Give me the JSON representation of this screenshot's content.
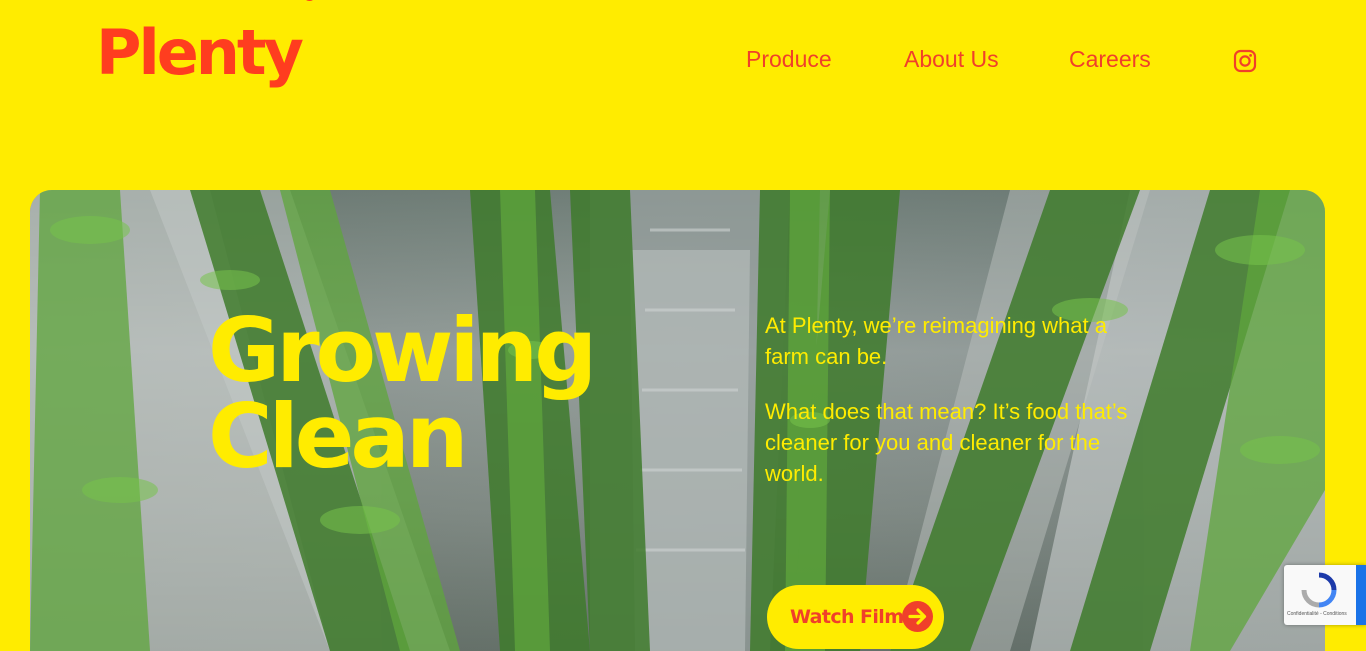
{
  "brand": {
    "name": "Plenty",
    "registered": "®"
  },
  "nav": {
    "items": [
      {
        "label": "Produce"
      },
      {
        "label": "About Us"
      },
      {
        "label": "Careers"
      }
    ],
    "social_icon": "instagram-icon"
  },
  "hero": {
    "headline_line1": "Growing",
    "headline_line2": "Clean",
    "paragraph1": "At Plenty, we’re reimagining what a farm can be.",
    "paragraph2": "What does that mean? It’s food that’s cleaner for you and cleaner for the world.",
    "cta_label": "Watch Film",
    "cta_icon": "arrow-right-icon"
  },
  "recaptcha": {
    "terms": "Confidentialité - Conditions"
  },
  "colors": {
    "background": "#FFEC00",
    "accent": "#F0402A",
    "logo": "#FF3D1F"
  }
}
